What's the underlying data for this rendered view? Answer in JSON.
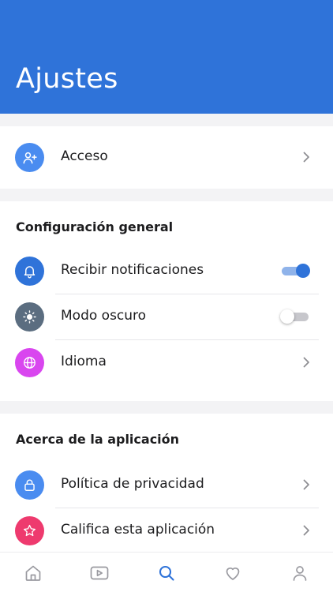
{
  "header": {
    "title": "Ajustes"
  },
  "colors": {
    "header_bg": "#2f73d9",
    "accent": "#2f73d9",
    "icon_acceso": "#4a8cf0",
    "icon_notificaciones": "#2f73d9",
    "icon_modo_oscuro": "#5b6d80",
    "icon_idioma": "#d946ef",
    "icon_privacidad": "#4a8cf0",
    "icon_califica": "#ee3a6e"
  },
  "account": {
    "items": [
      {
        "label": "Acceso",
        "icon": "user-plus-icon",
        "control": "chevron"
      }
    ]
  },
  "general": {
    "title": "Configuración general",
    "items": [
      {
        "label": "Recibir notificaciones",
        "icon": "bell-icon",
        "control": "toggle",
        "enabled": true
      },
      {
        "label": "Modo oscuro",
        "icon": "sun-icon",
        "control": "toggle",
        "enabled": false
      },
      {
        "label": "Idioma",
        "icon": "globe-icon",
        "control": "chevron"
      }
    ]
  },
  "about": {
    "title": "Acerca de la aplicación",
    "items": [
      {
        "label": "Política de privacidad",
        "icon": "lock-icon",
        "control": "chevron"
      },
      {
        "label": "Califica esta aplicación",
        "icon": "star-icon",
        "control": "chevron"
      }
    ]
  },
  "tabbar": {
    "active": "search",
    "items": [
      {
        "id": "home",
        "icon": "home-icon"
      },
      {
        "id": "video",
        "icon": "video-play-icon"
      },
      {
        "id": "search",
        "icon": "search-icon"
      },
      {
        "id": "favorites",
        "icon": "heart-icon"
      },
      {
        "id": "profile",
        "icon": "profile-icon"
      }
    ]
  }
}
